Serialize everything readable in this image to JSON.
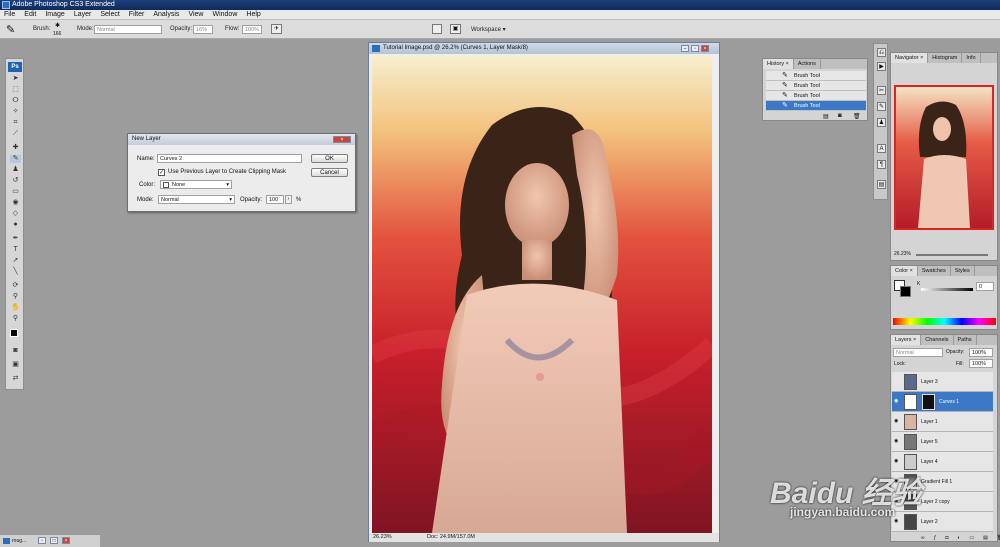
{
  "app": {
    "title": "Adobe Photoshop CS3 Extended"
  },
  "menu": [
    "File",
    "Edit",
    "Image",
    "Layer",
    "Select",
    "Filter",
    "Analysis",
    "View",
    "Window",
    "Help"
  ],
  "options": {
    "brush_label": "Brush:",
    "brush_size": "166",
    "mode_label": "Mode:",
    "mode_value": "Normal",
    "opacity_label": "Opacity:",
    "opacity_value": "16%",
    "flow_label": "Flow:",
    "flow_value": "100%",
    "workspace_label": "Workspace ▾"
  },
  "document": {
    "title": "Tutorial Image.psd @ 26.2% (Curves 1, Layer Mask/8)",
    "zoom": "26.23%",
    "doc_info": "Doc: 24.9M/157.0M"
  },
  "dialog": {
    "title": "New Layer",
    "name_label": "Name:",
    "name_value": "Curves 2",
    "clip_label": "Use Previous Layer to Create Clipping Mask",
    "clip_checked": true,
    "color_label": "Color:",
    "color_value": "None",
    "mode_label": "Mode:",
    "mode_value": "Normal",
    "opacity_label": "Opacity:",
    "opacity_value": "100",
    "opacity_unit": "%",
    "ok_label": "OK",
    "cancel_label": "Cancel"
  },
  "history": {
    "tabs": [
      "History ×",
      "Actions"
    ],
    "items": [
      "Brush Tool",
      "Brush Tool",
      "Brush Tool",
      "Brush Tool"
    ],
    "selected_index": 3
  },
  "navigator": {
    "tabs": [
      "Navigator ×",
      "Histogram",
      "Info"
    ],
    "zoom": "26.23%"
  },
  "color_panel": {
    "tabs": [
      "Color ×",
      "Swatches",
      "Styles"
    ],
    "channel_label": "K",
    "channel_value": "0"
  },
  "layers": {
    "tabs": [
      "Layers ×",
      "Channels",
      "Paths"
    ],
    "blend_mode": "Normal",
    "opacity_label": "Opacity:",
    "opacity_value": "100%",
    "lock_label": "Lock:",
    "fill_label": "Fill:",
    "fill_value": "100%",
    "items": [
      {
        "name": "Layer 3",
        "visible": false,
        "selected": false
      },
      {
        "name": "Curves 1",
        "visible": true,
        "selected": true
      },
      {
        "name": "Layer 1",
        "visible": true,
        "selected": false
      },
      {
        "name": "Layer 5",
        "visible": true,
        "selected": false
      },
      {
        "name": "Layer 4",
        "visible": true,
        "selected": false
      },
      {
        "name": "Gradient Fill 1",
        "visible": true,
        "selected": false
      },
      {
        "name": "Layer 2 copy",
        "visible": true,
        "selected": false
      },
      {
        "name": "Layer 2",
        "visible": true,
        "selected": false
      }
    ]
  },
  "taskbar": {
    "item_label": "roug..."
  },
  "watermark": {
    "brand": "Baidu 经验",
    "url": "jingyan.baidu.com"
  },
  "colors": {
    "selection": "#3b78c5",
    "title_bar": "#0f2a5c",
    "canvas_red": "#c8202a"
  }
}
